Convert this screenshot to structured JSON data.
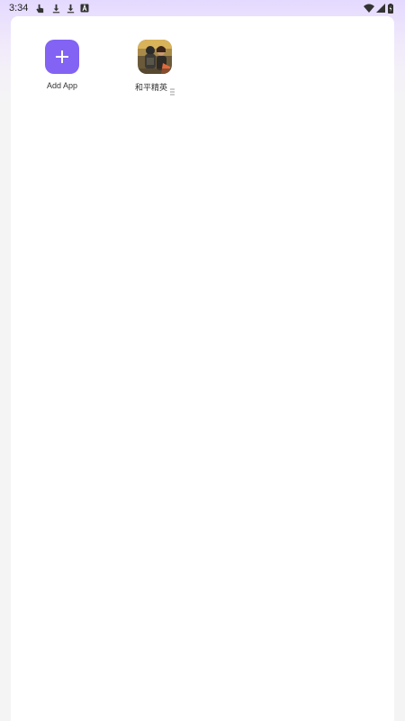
{
  "status_bar": {
    "time": "3:34",
    "left_icons": [
      "touch-icon",
      "download-icon",
      "download-icon",
      "text-a-icon"
    ],
    "right_icons": [
      "wifi-icon",
      "signal-icon",
      "battery-icon"
    ]
  },
  "apps": [
    {
      "label": "Add App",
      "icon": "plus-icon",
      "color": "#8263F3"
    },
    {
      "label": "和平精英",
      "icon": "game-app-icon"
    }
  ]
}
